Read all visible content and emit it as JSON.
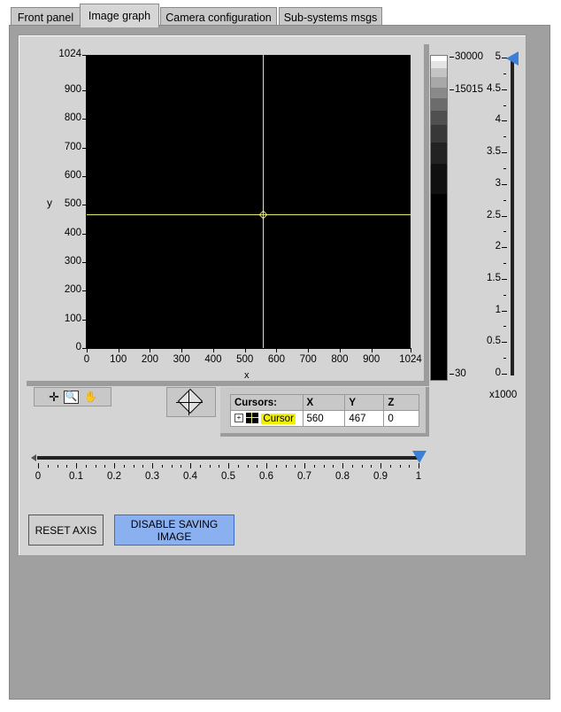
{
  "tabs": [
    "Front panel",
    "Image graph",
    "Camera configuration",
    "Sub-systems msgs"
  ],
  "graph": {
    "xlabel": "x",
    "ylabel": "y",
    "xticks": [
      "0",
      "100",
      "200",
      "300",
      "400",
      "500",
      "600",
      "700",
      "800",
      "900",
      "1024"
    ],
    "yticks": [
      "1024",
      "900",
      "800",
      "700",
      "600",
      "500",
      "400",
      "300",
      "200",
      "100",
      "0"
    ],
    "range": [
      0,
      1024
    ],
    "cursor_color": "#e8e86a"
  },
  "colorramp": {
    "labels": [
      "30000",
      "15015",
      "30"
    ],
    "values": [
      30000,
      15015,
      30
    ]
  },
  "scale": {
    "labels": [
      "5",
      "4.5",
      "4",
      "3.5",
      "3",
      "2.5",
      "2",
      "1.5",
      "1",
      "0.5",
      "0"
    ],
    "multiplier": "x1000",
    "value": 5
  },
  "slider": {
    "labels": [
      "0",
      "0.1",
      "0.2",
      "0.3",
      "0.4",
      "0.5",
      "0.6",
      "0.7",
      "0.8",
      "0.9",
      "1"
    ],
    "value": 1
  },
  "cursors": {
    "headers": [
      "Cursors:",
      "X",
      "Y",
      "Z"
    ],
    "name": "Cursor",
    "x": "560",
    "y": "467",
    "z": "0"
  },
  "buttons": {
    "reset_axis": "RESET AXIS",
    "disable_saving": "DISABLE SAVING IMAGE"
  }
}
